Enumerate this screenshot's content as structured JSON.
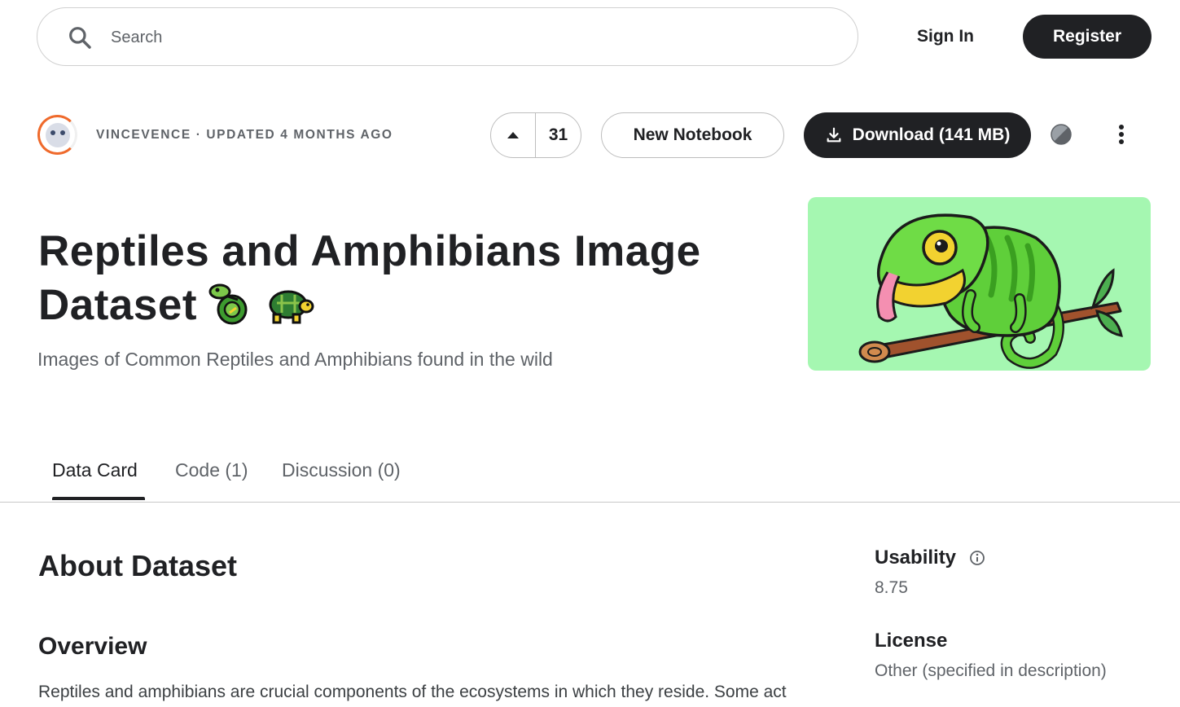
{
  "header": {
    "search_placeholder": "Search",
    "signin_label": "Sign In",
    "register_label": "Register"
  },
  "dataset": {
    "owner": "VINCEVENCE",
    "separator": " · ",
    "updated": "UPDATED 4 MONTHS AGO",
    "upvotes": "31",
    "new_notebook_label": "New Notebook",
    "download_label": "Download (141 MB)",
    "title": "Reptiles and Amphibians Image Dataset",
    "subtitle": "Images of Common Reptiles and Amphibians found in the wild"
  },
  "tabs": [
    {
      "label": "Data Card"
    },
    {
      "label": "Code (1)"
    },
    {
      "label": "Discussion (0)"
    }
  ],
  "active_tab": "Data Card",
  "content": {
    "about_heading": "About Dataset",
    "overview_heading": "Overview",
    "overview_text": "Reptiles and amphibians are crucial components of the ecosystems in which they reside. Some act"
  },
  "sidebar": {
    "usability_label": "Usability",
    "usability_value": "8.75",
    "license_label": "License",
    "license_value": "Other (specified in description)"
  },
  "icons": {
    "search": "search-icon",
    "upvote": "upvote-arrow-icon",
    "download": "download-icon",
    "theme": "theme-toggle-icon",
    "more": "more-vert-icon",
    "info": "info-icon",
    "emoji_1": "lizard-emoji-icon",
    "emoji_2": "turtle-emoji-icon"
  },
  "colors": {
    "primary_dark": "#202124",
    "muted_text": "#5f6368",
    "hero_bg": "#a5f7b1",
    "avatar_ring": "#ef6a2c"
  }
}
